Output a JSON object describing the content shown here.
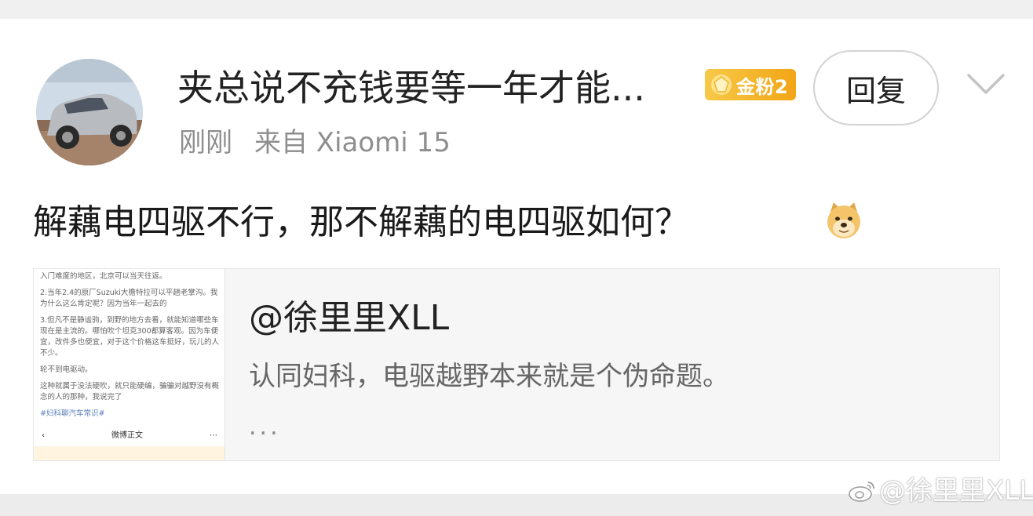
{
  "comment": {
    "author": "夹总说不充钱要等一年才能...",
    "badge_label": "金粉2",
    "reply_button": "回复",
    "time": "刚刚",
    "source": "来自 Xiaomi 15",
    "text": "解藕电四驱不行，那不解藕的电四驱如何？"
  },
  "quoted": {
    "user": "@徐里里XLL",
    "text": "认同妇科，电驱越野本来就是个伪命题。",
    "more": "...",
    "thumbnail": {
      "lines": [
        "入门难度的地区，北京可以当天往返。",
        "2.当年2.4的原厂Suzuki大檐特拉可以平趟老掌沟。我为什么这么肯定呢？因为当年一起去的",
        "3.但凡不是静谧驹，到野的地方去看，就能知道哪些车现在是主流的。哪怕吹个坦克300都算客观。因为车便宜，改件多也便宜，对于这个价格这车挺好，玩儿的人不少。",
        "轮不到电驱动。",
        "这种就属于没法硬吹，就只能硬编，骗骗对越野没有概念的人的那种，我说完了"
      ],
      "hashtag": "#妇科聊汽车常识#",
      "nav_title": "微博正文"
    }
  },
  "watermark": "@徐里里XLL",
  "colors": {
    "badge": "#f2a516",
    "meta_gray": "#8e8e8e",
    "quote_bg": "#f6f6f6"
  },
  "icons": {
    "avatar": "car-photo-avatar",
    "badge": "gem-icon",
    "chevron": "chevron-down-icon",
    "emoji": "doge-emoji-icon",
    "watermark": "weibo-logo-icon"
  }
}
